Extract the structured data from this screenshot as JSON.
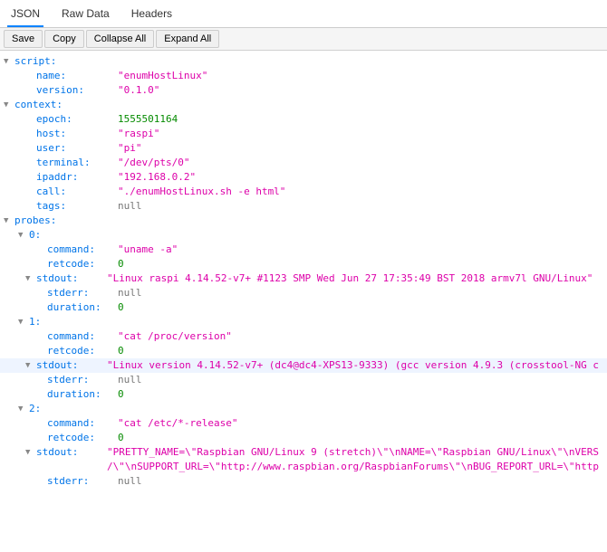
{
  "tabs": {
    "json": "JSON",
    "raw": "Raw Data",
    "headers": "Headers"
  },
  "toolbar": {
    "save": "Save",
    "copy": "Copy",
    "collapse": "Collapse All",
    "expand": "Expand All"
  },
  "tree": {
    "script": {
      "name": "\"enumHostLinux\"",
      "version": "\"0.1.0\""
    },
    "context": {
      "epoch": "1555501164",
      "host": "\"raspi\"",
      "user": "\"pi\"",
      "terminal": "\"/dev/pts/0\"",
      "ipaddr": "\"192.168.0.2\"",
      "call": "\"./enumHostLinux.sh -e html\"",
      "tags": "null"
    },
    "probes": [
      {
        "command": "\"uname -a\"",
        "retcode": "0",
        "stdout": "\"Linux raspi 4.14.52-v7+ #1123 SMP Wed Jun 27 17:35:49 BST 2018 armv7l GNU/Linux\"",
        "stderr": "null",
        "duration": "0"
      },
      {
        "command": "\"cat /proc/version\"",
        "retcode": "0",
        "stdout": "\"Linux version 4.14.52-v7+ (dc4@dc4-XPS13-9333) (gcc version 4.9.3 (crosstool-NG c",
        "stderr": "null",
        "duration": "0"
      },
      {
        "command": "\"cat /etc/*-release\"",
        "retcode": "0",
        "stdout": "\"PRETTY_NAME=\\\"Raspbian GNU/Linux 9 (stretch)\\\"\\nNAME=\\\"Raspbian GNU/Linux\\\"\\nVERS\n/\\\"\\nSUPPORT_URL=\\\"http://www.raspbian.org/RaspbianForums\\\"\\nBUG_REPORT_URL=\\\"http",
        "stderr": "null"
      }
    ]
  },
  "keys": {
    "script": "script",
    "name": "name",
    "version": "version",
    "context": "context",
    "epoch": "epoch",
    "host": "host",
    "user": "user",
    "terminal": "terminal",
    "ipaddr": "ipaddr",
    "call": "call",
    "tags": "tags",
    "probes": "probes",
    "command": "command",
    "retcode": "retcode",
    "stdout": "stdout",
    "stderr": "stderr",
    "duration": "duration",
    "i0": "0",
    "i1": "1",
    "i2": "2"
  }
}
